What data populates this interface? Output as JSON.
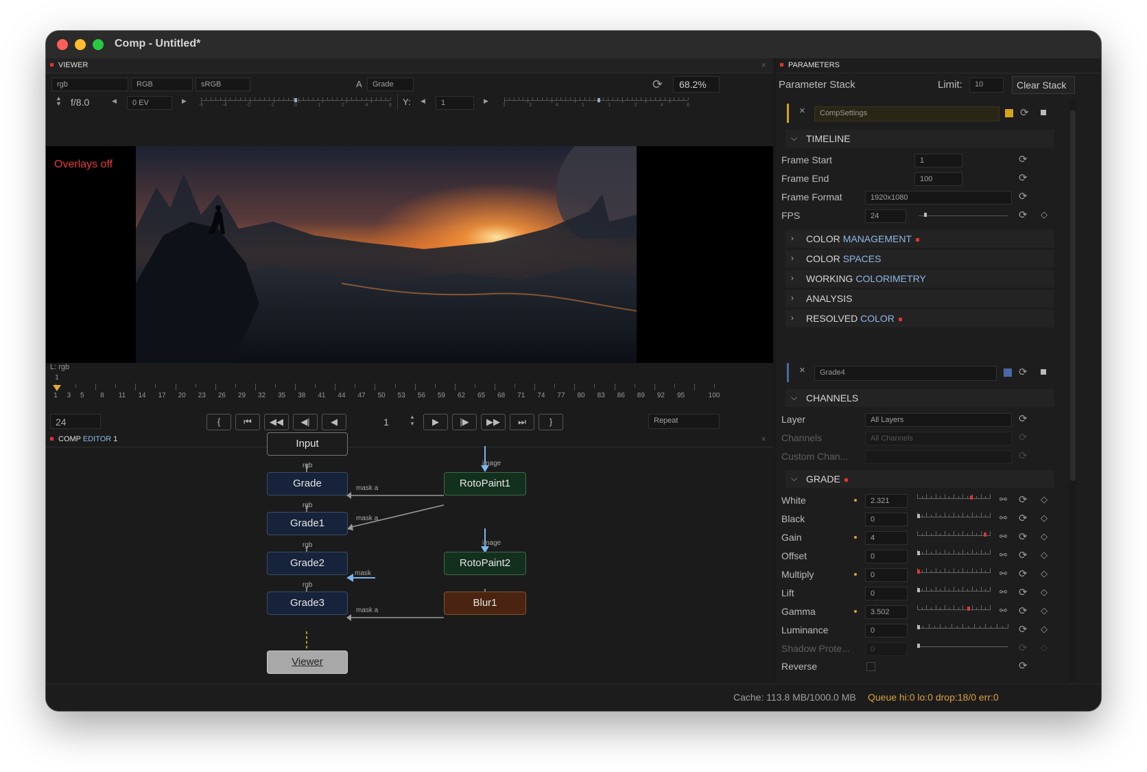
{
  "window": {
    "title": "Comp - Untitled*"
  },
  "viewer": {
    "tab_label": "VIEWER",
    "channel_field": "rgb",
    "colorspace_field": "RGB",
    "display_field": "sRGB",
    "a_label": "A",
    "a_value": "Grade",
    "zoom": "68.2%",
    "fstop": "f/8.0",
    "exposure": "0 EV",
    "y_label": "Y:",
    "y_value": "1",
    "overlays": "Overlays off",
    "layer_info": "L: rgb",
    "exposure_ticks": [
      "-6",
      "-4",
      "-2",
      "-1",
      "0",
      "1",
      "2",
      "4",
      "6"
    ],
    "y_ticks": [
      "1",
      "2",
      "4",
      "1",
      "1",
      "2",
      "4",
      "8"
    ]
  },
  "timeline": {
    "ticks": [
      "1",
      "3",
      "5",
      "8",
      "11",
      "14",
      "17",
      "20",
      "23",
      "26",
      "29",
      "32",
      "35",
      "38",
      "41",
      "44",
      "47",
      "50",
      "53",
      "56",
      "59",
      "62",
      "65",
      "68",
      "71",
      "74",
      "77",
      "80",
      "83",
      "86",
      "89",
      "92",
      "95",
      "100"
    ],
    "playhead_marker": "1",
    "fps_field": "24",
    "current_frame": "1",
    "repeat_mode": "Repeat",
    "buttons": {
      "in_point": "{",
      "first": "⏮",
      "rewind": "◀◀",
      "step_back": "◀|",
      "play_back": "◀",
      "play": "▶",
      "step_fwd": "|▶",
      "fast_fwd": "▶▶",
      "last": "⏭",
      "out_point": "}"
    }
  },
  "comp_editor": {
    "tab_label": "COMP",
    "tab_label_accent": "EDITOR",
    "tab_suffix": "1",
    "nodes": {
      "input": "Input",
      "grade": "Grade",
      "grade1": "Grade1",
      "grade2": "Grade2",
      "grade3": "Grade3",
      "roto1": "RotoPaint1",
      "roto2": "RotoPaint2",
      "blur1": "Blur1",
      "viewer": "Viewer"
    },
    "edge_labels": {
      "rgb": "rgb",
      "image": "image",
      "mask_a": "mask a",
      "mask": "mask"
    }
  },
  "parameters": {
    "tab_label": "PARAMETERS",
    "stack_label": "Parameter Stack",
    "limit_label": "Limit:",
    "limit_value": "10",
    "clear_stack": "Clear Stack",
    "comp_settings": {
      "name": "CompSettings",
      "color": "#d6a414",
      "timeline_section": "TIMELINE",
      "frame_start_label": "Frame Start",
      "frame_start": "1",
      "frame_end_label": "Frame End",
      "frame_end": "100",
      "frame_format_label": "Frame Format",
      "frame_format": "1920x1080",
      "fps_label": "FPS",
      "fps": "24",
      "sections": [
        {
          "a": "COLOR",
          "b": "MANAGEMENT",
          "marked": true
        },
        {
          "a": "COLOR",
          "b": "SPACES",
          "marked": false
        },
        {
          "a": "WORKING",
          "b": "COLORIMETRY",
          "marked": false
        },
        {
          "a": "ANALYSIS",
          "b": "",
          "marked": false
        },
        {
          "a": "RESOLVED",
          "b": "COLOR",
          "marked": true
        }
      ]
    },
    "grade4": {
      "name": "Grade4",
      "color": "#4a68a8",
      "channels_section": "CHANNELS",
      "layer_label": "Layer",
      "layer": "All Layers",
      "channels_label": "Channels",
      "channels": "All Channels",
      "custom_label": "Custom Chan...",
      "grade_section": "GRADE",
      "params": [
        {
          "label": "White",
          "value": "2.321",
          "modified": true,
          "knob": 0.75,
          "red": true
        },
        {
          "label": "Black",
          "value": "0",
          "modified": false,
          "knob": 0.0,
          "red": false
        },
        {
          "label": "Gain",
          "value": "4",
          "modified": true,
          "knob": 0.95,
          "red": true
        },
        {
          "label": "Offset",
          "value": "0",
          "modified": false,
          "knob": 0.0,
          "red": false
        },
        {
          "label": "Multiply",
          "value": "0",
          "modified": true,
          "knob": 0.0,
          "red": true
        },
        {
          "label": "Lift",
          "value": "0",
          "modified": false,
          "knob": 0.0,
          "red": false
        },
        {
          "label": "Gamma",
          "value": "3.502",
          "modified": true,
          "knob": 0.72,
          "red": true
        },
        {
          "label": "Luminance",
          "value": "0",
          "modified": false,
          "knob": 0.0,
          "red": false
        },
        {
          "label": "Shadow Prote...",
          "value": "0",
          "modified": false,
          "knob": 0.0,
          "red": false,
          "disabled": true
        }
      ],
      "reverse_label": "Reverse"
    }
  },
  "status": {
    "cache": "Cache: 113.8 MB/1000.0 MB",
    "queue": "Queue hi:0 lo:0 drop:18/0 err:0"
  }
}
